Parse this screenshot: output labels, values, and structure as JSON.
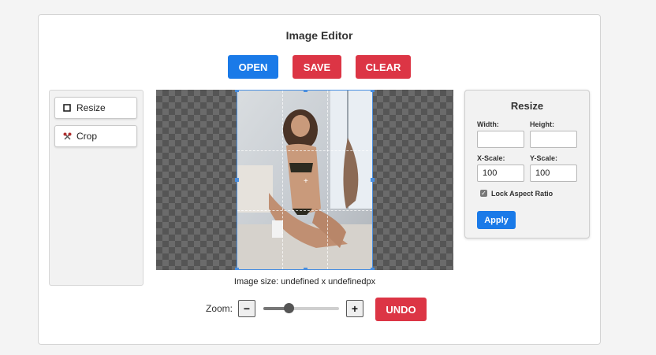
{
  "editor": {
    "title": "Image Editor"
  },
  "toolbar": {
    "open_label": "OPEN",
    "save_label": "SAVE",
    "clear_label": "CLEAR"
  },
  "tools": [
    {
      "label": "Resize",
      "icon": "square-icon"
    },
    {
      "label": "Crop",
      "icon": "crop-icon"
    }
  ],
  "canvas": {
    "size_text": "Image size: undefined x undefinedpx"
  },
  "zoom": {
    "label": "Zoom:",
    "minus": "−",
    "plus": "+",
    "value_fraction": 0.33
  },
  "undo_label": "UNDO",
  "resize_panel": {
    "title": "Resize",
    "width_label": "Width:",
    "height_label": "Height:",
    "width_value": "",
    "height_value": "",
    "xscale_label": "X-Scale:",
    "yscale_label": "Y-Scale:",
    "xscale_value": "100",
    "yscale_value": "100",
    "lock_label": "Lock Aspect Ratio",
    "lock_checked": true,
    "apply_label": "Apply"
  },
  "colors": {
    "primary": "#1a7ae8",
    "danger": "#dc3545",
    "selection": "#4a8fe0"
  }
}
